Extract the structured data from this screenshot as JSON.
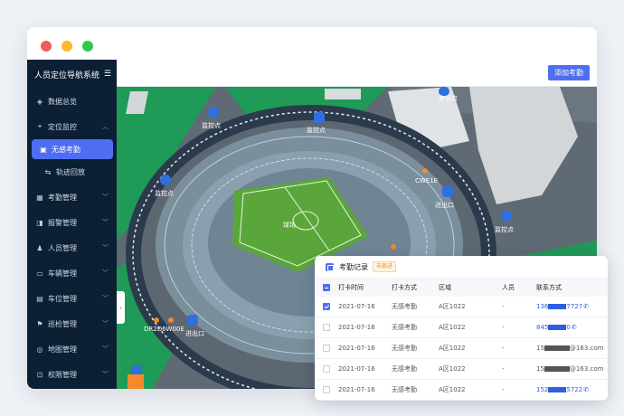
{
  "app": {
    "title": "人员定位导航系统"
  },
  "sidebar": {
    "items": [
      {
        "label": "数据总览",
        "icon": "dashboard-icon"
      },
      {
        "label": "定位监控",
        "icon": "location-icon",
        "expanded": true
      },
      {
        "label": "无感考勤",
        "icon": "attendance-icon",
        "active": true,
        "sub": true
      },
      {
        "label": "轨迹回放",
        "icon": "track-icon",
        "sub": true
      },
      {
        "label": "考勤管理",
        "icon": "calendar-icon"
      },
      {
        "label": "报警管理",
        "icon": "alarm-icon"
      },
      {
        "label": "人员管理",
        "icon": "person-icon"
      },
      {
        "label": "车辆管理",
        "icon": "vehicle-icon"
      },
      {
        "label": "车位管理",
        "icon": "parking-icon"
      },
      {
        "label": "巡检管理",
        "icon": "patrol-icon"
      },
      {
        "label": "地图管理",
        "icon": "map-icon"
      },
      {
        "label": "权限管理",
        "icon": "permission-icon"
      }
    ]
  },
  "toolbar": {
    "add_label": "添加考勤"
  },
  "map": {
    "labels": [
      "监控点",
      "监控点",
      "监控点",
      "监控点",
      "监控点",
      "进出口",
      "进出口",
      "球场",
      "CWE1E",
      "DR2D6W00E",
      "安全点"
    ]
  },
  "panel": {
    "title": "考勤记录",
    "badge": "未跟进",
    "columns": [
      "打卡时间",
      "打卡方式",
      "区域",
      "人员",
      "联系方式"
    ],
    "rows": [
      {
        "time": "2021-07-16",
        "method": "无感考勤",
        "area": "A区1022",
        "person": "-",
        "phone_a": "136",
        "phone_b": "7727",
        "masked": "blue",
        "checked": true
      },
      {
        "time": "2021-07-16",
        "method": "无感考勤",
        "area": "A区1022",
        "person": "-",
        "phone_a": "845",
        "phone_b": "0",
        "masked": "blue",
        "checked": false
      },
      {
        "time": "2021-07-16",
        "method": "无感考勤",
        "area": "A区1022",
        "person": "-",
        "phone_a": "15",
        "phone_b": "@163.com",
        "masked": "dark",
        "checked": false
      },
      {
        "time": "2021-07-16",
        "method": "无感考勤",
        "area": "A区1022",
        "person": "-",
        "phone_a": "15",
        "phone_b": "@163.com",
        "masked": "dark",
        "checked": false
      },
      {
        "time": "2021-07-16",
        "method": "无感考勤",
        "area": "A区1022",
        "person": "-",
        "phone_a": "152",
        "phone_b": "5722",
        "masked": "blue",
        "checked": false
      }
    ]
  },
  "colors": {
    "accent": "#4e6ef2",
    "sidebar": "#0b1f35",
    "field": "#5aa63a",
    "grass": "#1f9a57"
  }
}
